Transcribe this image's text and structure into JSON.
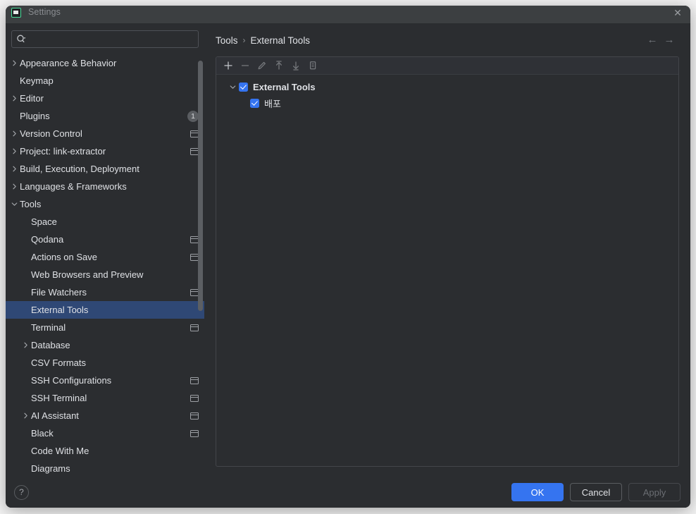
{
  "window": {
    "title": "Settings",
    "app_icon": "pycharm-icon",
    "close_label": "✕"
  },
  "search": {
    "value": "",
    "placeholder": "",
    "icon": "search-icon"
  },
  "sidebar": {
    "items": [
      {
        "label": "Appearance & Behavior",
        "level": 0,
        "twisty": "collapsed",
        "badge": null,
        "scope": false,
        "selected": false
      },
      {
        "label": "Keymap",
        "level": 0,
        "twisty": "none",
        "badge": null,
        "scope": false,
        "selected": false
      },
      {
        "label": "Editor",
        "level": 0,
        "twisty": "collapsed",
        "badge": null,
        "scope": false,
        "selected": false
      },
      {
        "label": "Plugins",
        "level": 0,
        "twisty": "none",
        "badge": "1",
        "scope": false,
        "selected": false
      },
      {
        "label": "Version Control",
        "level": 0,
        "twisty": "collapsed",
        "badge": null,
        "scope": true,
        "selected": false
      },
      {
        "label": "Project: link-extractor",
        "level": 0,
        "twisty": "collapsed",
        "badge": null,
        "scope": true,
        "selected": false
      },
      {
        "label": "Build, Execution, Deployment",
        "level": 0,
        "twisty": "collapsed",
        "badge": null,
        "scope": false,
        "selected": false
      },
      {
        "label": "Languages & Frameworks",
        "level": 0,
        "twisty": "collapsed",
        "badge": null,
        "scope": false,
        "selected": false
      },
      {
        "label": "Tools",
        "level": 0,
        "twisty": "expanded",
        "badge": null,
        "scope": false,
        "selected": false
      },
      {
        "label": "Space",
        "level": 1,
        "twisty": "none",
        "badge": null,
        "scope": false,
        "selected": false
      },
      {
        "label": "Qodana",
        "level": 1,
        "twisty": "none",
        "badge": null,
        "scope": true,
        "selected": false
      },
      {
        "label": "Actions on Save",
        "level": 1,
        "twisty": "none",
        "badge": null,
        "scope": true,
        "selected": false
      },
      {
        "label": "Web Browsers and Preview",
        "level": 1,
        "twisty": "none",
        "badge": null,
        "scope": false,
        "selected": false
      },
      {
        "label": "File Watchers",
        "level": 1,
        "twisty": "none",
        "badge": null,
        "scope": true,
        "selected": false
      },
      {
        "label": "External Tools",
        "level": 1,
        "twisty": "none",
        "badge": null,
        "scope": false,
        "selected": true
      },
      {
        "label": "Terminal",
        "level": 1,
        "twisty": "none",
        "badge": null,
        "scope": true,
        "selected": false
      },
      {
        "label": "Database",
        "level": 1,
        "twisty": "collapsed",
        "badge": null,
        "scope": false,
        "selected": false
      },
      {
        "label": "CSV Formats",
        "level": 1,
        "twisty": "none",
        "badge": null,
        "scope": false,
        "selected": false
      },
      {
        "label": "SSH Configurations",
        "level": 1,
        "twisty": "none",
        "badge": null,
        "scope": true,
        "selected": false
      },
      {
        "label": "SSH Terminal",
        "level": 1,
        "twisty": "none",
        "badge": null,
        "scope": true,
        "selected": false
      },
      {
        "label": "AI Assistant",
        "level": 1,
        "twisty": "collapsed",
        "badge": null,
        "scope": true,
        "selected": false
      },
      {
        "label": "Black",
        "level": 1,
        "twisty": "none",
        "badge": null,
        "scope": true,
        "selected": false
      },
      {
        "label": "Code With Me",
        "level": 1,
        "twisty": "none",
        "badge": null,
        "scope": false,
        "selected": false
      },
      {
        "label": "Diagrams",
        "level": 1,
        "twisty": "none",
        "badge": null,
        "scope": false,
        "selected": false
      }
    ]
  },
  "content": {
    "breadcrumb": {
      "root": "Tools",
      "separator": "›",
      "leaf": "External Tools"
    },
    "nav_back": "←",
    "nav_forward": "→",
    "toolbar": [
      {
        "name": "add-tool-button",
        "glyph": "+",
        "enabled": true
      },
      {
        "name": "remove-tool-button",
        "glyph": "−",
        "enabled": false
      },
      {
        "name": "edit-tool-button",
        "glyph": "pencil-icon",
        "enabled": false
      },
      {
        "name": "move-up-button",
        "glyph": "arrow-up-icon",
        "enabled": false
      },
      {
        "name": "move-down-button",
        "glyph": "arrow-down-icon",
        "enabled": false
      },
      {
        "name": "copy-tool-button",
        "glyph": "copy-icon",
        "enabled": false
      }
    ],
    "tree": [
      {
        "label": "External Tools",
        "level": 0,
        "twisty": "expanded",
        "checked": true,
        "bold": true
      },
      {
        "label": "배포",
        "level": 1,
        "twisty": "none",
        "checked": true,
        "bold": false
      }
    ]
  },
  "footer": {
    "help": "?",
    "ok": "OK",
    "cancel": "Cancel",
    "apply": "Apply"
  },
  "colors": {
    "accent": "#3574F0",
    "selection": "#2F4875",
    "panel_bg": "#2B2D30",
    "titlebar_bg": "#3C3F41",
    "text": "#DFE1E5",
    "text_dim": "#8A8D91"
  }
}
